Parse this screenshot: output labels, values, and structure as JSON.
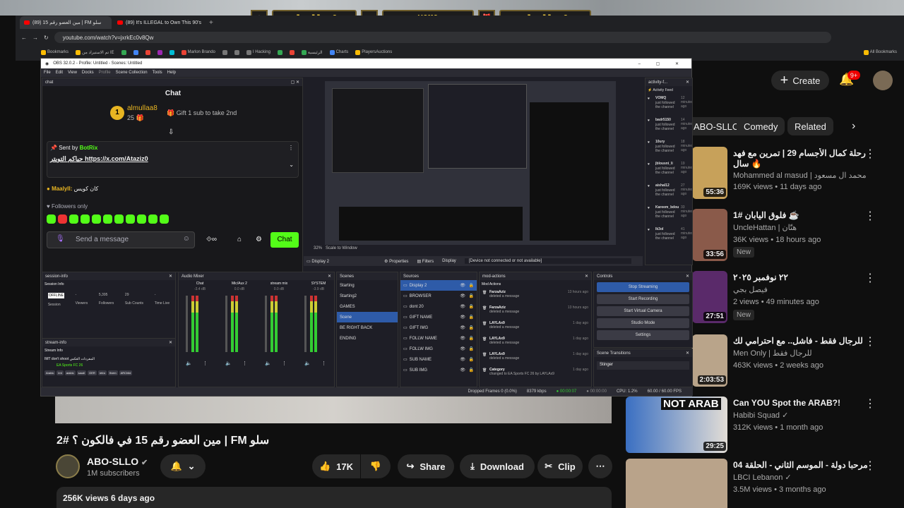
{
  "browser": {
    "tabs": [
      "(89) مين العضو رقم 15 | FM سلو",
      "(89) It's ILLEGAL to Own This 90's"
    ],
    "url": "youtube.com/watch?v=jxrkEc0v8Qw",
    "bookmarks": [
      "Bookmarks",
      "تم الاستيراد من IE",
      "Marlon Brando",
      "I Hacking",
      "الرئيسية",
      "Charts",
      "PlayersAuctions",
      "All Bookmarks"
    ]
  },
  "overlay": {
    "names": [
      "almullaa8",
      "VOMQ",
      "almullaa8"
    ]
  },
  "obs": {
    "title": "OBS 32.0.2 - Profile: Untitled - Scenes: Untitled",
    "menu": [
      "File",
      "Edit",
      "View",
      "Docks",
      "Profile",
      "Scene Collection",
      "Tools",
      "Help"
    ],
    "chat_dock_label": "chat",
    "chat": {
      "header": "Chat",
      "gifter": "almullaa8",
      "gifter_count": "25",
      "gift_text": "Gift 1 sub to take 2nd",
      "pinned_sender": "Sent by",
      "pinned_bot": "BotRix",
      "pinned_text": "حياكم التويتر https://x.com/Ataziz0",
      "msg_user": "Maalyll:",
      "msg_text": "كان كويس",
      "followers_only": "Followers only",
      "placeholder": "Send a message",
      "send_btn": "Chat"
    },
    "display": {
      "zoom": "32%",
      "scale": "Scale to Window",
      "properties": "Properties",
      "filters": "Filters",
      "display_label": "Display",
      "display_name": "Display 2",
      "status": "[Device not connected or not available]"
    },
    "activity": {
      "dock_label": "activity-f...",
      "title": "Activity Feed",
      "items": [
        {
          "user": "VOMQ",
          "text": "just followed the channel",
          "time": "12 minutes ago"
        },
        {
          "user": "badr5150",
          "text": "just followed the channel",
          "time": "14 minutes ago"
        },
        {
          "user": "10ury",
          "text": "just followed the channel",
          "time": "18 minutes ago"
        },
        {
          "user": "jblousni_li",
          "text": "just followed the channel",
          "time": "19 minutes ago"
        },
        {
          "user": "aishal12",
          "text": "just followed the channel",
          "time": "27 minutes ago"
        },
        {
          "user": "Kareem_bdou",
          "text": "just followed the channel",
          "time": "33 minutes ago"
        },
        {
          "user": "lk3ol",
          "text": "just followed the channel",
          "time": "41 minutes ago"
        }
      ]
    },
    "session": {
      "dock_label": "session-info",
      "title": "Session Info",
      "status": "OFFLINE",
      "status_label": "Session",
      "viewers_label": "Viewers",
      "viewers": "-",
      "followers": "5,395",
      "followers_label": "Followers",
      "subs": "29",
      "subs_label": "Sub Counts",
      "time_label": "Time Live",
      "time": "-"
    },
    "streaminfo": {
      "dock_label": "stream-info",
      "title": "Stream Info",
      "stream_title": "IMT don't shoot المفردات العكس",
      "category": "EA Sports FC 26",
      "tags": [
        "Arabic",
        "imt",
        "arabic",
        "saudi",
        "GER",
        "retro",
        "fivem",
        "ARChild"
      ]
    },
    "mixer": {
      "dock_label": "Audio Mixer",
      "channels": [
        {
          "name": "Chat",
          "db": "-3.4 dB"
        },
        {
          "name": "Mic/Aux 2",
          "db": "0.0 dB"
        },
        {
          "name": "stream mix",
          "db": "0.0 dB"
        },
        {
          "name": "SYSTEM",
          "db": "-3.9 dB"
        }
      ]
    },
    "scenes": {
      "dock_label": "Scenes",
      "items": [
        "Starting",
        "Starting2",
        "GAMES",
        "Scene",
        "BE RIGHT BACK",
        "ENDING"
      ],
      "selected": 3
    },
    "sources": {
      "dock_label": "Sources",
      "items": [
        "Display 2",
        "BROWSER",
        "dont 20",
        "GIFT NAME",
        "GIFT IMG",
        "FOLLW NAME",
        "FOLLW IMG",
        "SUB NAME",
        "SUB IMG"
      ],
      "selected": 0
    },
    "modactions": {
      "dock_label": "mod-actions",
      "title": "Mod Actions",
      "items": [
        {
          "user": "FarzaAziz",
          "text": "deleted a message",
          "time": "13 hours ago"
        },
        {
          "user": "FarzaAziz",
          "text": "deleted a message",
          "time": "13 hours ago"
        },
        {
          "user": "LAYLAx9",
          "text": "deleted a message",
          "time": "1 day ago"
        },
        {
          "user": "LAYLAx9",
          "text": "deleted a message",
          "time": "1 day ago"
        },
        {
          "user": "LAYLAx9",
          "text": "deleted a message",
          "time": "1 day ago"
        },
        {
          "user": "Category",
          "text": "changed to EA Sports FC 26 by LAYLAx9",
          "time": "1 day ago"
        }
      ]
    },
    "controls": {
      "dock_label": "Controls",
      "buttons": [
        "Stop Streaming",
        "Start Recording",
        "Start Virtual Camera",
        "Studio Mode",
        "Settings"
      ]
    },
    "transitions": {
      "dock_label": "Scene Transitions",
      "value": "Stinger"
    },
    "status": {
      "dropped": "Dropped Frames 0 (0.0%)",
      "kbps": "8379 kbps",
      "live": "00:00:07",
      "rec": "00:00:00",
      "cpu": "CPU: 1.2%",
      "fps": "60.00 / 60.00 FPS"
    }
  },
  "youtube": {
    "create": "Create",
    "notif_count": "9+",
    "chips": [
      "ABO-SLLO",
      "Comedy",
      "Related"
    ],
    "recs": [
      {
        "title": "رحلة كمال الأجسام 29 | تمرين مع فهد سال 🔥",
        "channel": "Mohammed al masud | محمد ال مسعود",
        "meta": "169K views • 11 days ago",
        "duration": "55:36"
      },
      {
        "title": "فلوق اليابان #1 ☕",
        "channel": "UncleHattan | هتّان",
        "meta": "36K views • 18 hours ago",
        "duration": "33:56",
        "badge": "New"
      },
      {
        "title": "٢٢ نوفمبر ٢٠٢٥",
        "channel": "فيصل بجي",
        "meta": "2 views • 49 minutes ago",
        "duration": "27:51",
        "badge": "New"
      },
      {
        "title": "للرجال فقط - فاشل.. مع احترامي لك",
        "channel": "Men Only | للرجال فقط",
        "meta": "463K views • 2 weeks ago",
        "duration": "2:03:53"
      },
      {
        "title": "Can YOU Spot the ARAB?!",
        "channel": "Habibi Squad ✓",
        "meta": "312K views • 1 month ago",
        "duration": "29:25",
        "thumb_text": "NOT ARAB"
      },
      {
        "title": "مرحبا دولة - الموسم الثاني - الحلقة 04",
        "channel": "LBCI Lebanon ✓",
        "meta": "3.5M views • 3 months ago",
        "duration": ""
      }
    ],
    "video_title": "مين العضو رقم 15 في فالكون ؟ #2 | FM سلو",
    "channel": "ABO-SLLO",
    "subs": "1M subscribers",
    "likes": "17K",
    "share": "Share",
    "download": "Download",
    "clip": "Clip",
    "views_line": "256K views  6 days ago"
  },
  "colors": {
    "accent": "#53fc18",
    "obs_select": "#2e5ba8",
    "yt_red": "#ff0000"
  }
}
